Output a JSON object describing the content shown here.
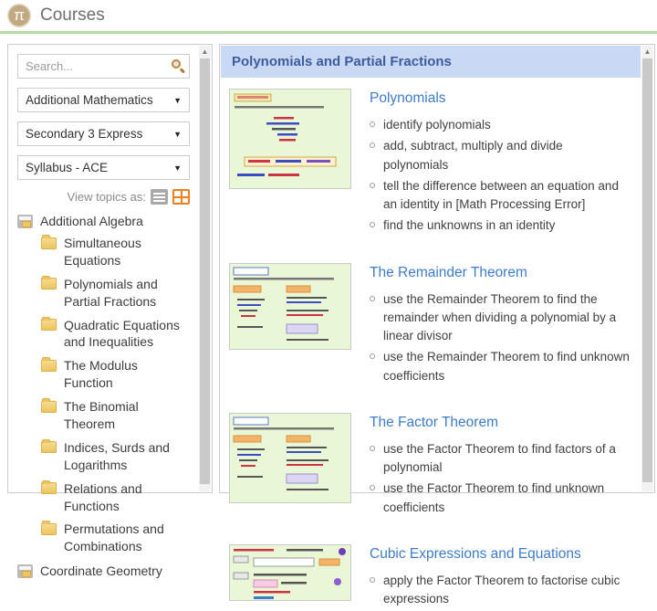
{
  "header": {
    "title": "Courses",
    "logo_glyph": "π"
  },
  "colors": {
    "accent_green": "#b4dba4",
    "logo_tan": "#c2a982",
    "header_blue": "#c9d9f3",
    "link_blue": "#3d7cc9",
    "folder_yellow": "#f0c75e",
    "orange": "#ee7f1b"
  },
  "sidebar": {
    "search_placeholder": "Search...",
    "filters": [
      {
        "name": "subject-dropdown",
        "value": "Additional Mathematics"
      },
      {
        "name": "level-dropdown",
        "value": "Secondary 3 Express"
      },
      {
        "name": "syllabus-dropdown",
        "value": "Syllabus - ACE"
      }
    ],
    "view_topics_label": "View topics as:",
    "tree": [
      {
        "label": "Additional Algebra",
        "type": "category",
        "children": [
          "Simultaneous Equations",
          "Polynomials and Partial Fractions",
          "Quadratic Equations and Inequalities",
          "The Modulus Function",
          "The Binomial Theorem",
          "Indices, Surds and Logarithms",
          "Relations and Functions",
          "Permutations and Combinations"
        ]
      },
      {
        "label": "Coordinate Geometry",
        "type": "category",
        "children": []
      }
    ]
  },
  "main": {
    "header": "Polynomials and Partial Fractions",
    "topics": [
      {
        "title": "Polynomials",
        "thumb_variant": 1,
        "thumb_height": 108,
        "objectives": [
          "identify polynomials",
          "add, subtract, multiply and divide polynomials",
          "tell the difference between an equation and an identity in [Math Processing Error]",
          "find the unknowns in an identity"
        ]
      },
      {
        "title": "The Remainder Theorem",
        "thumb_variant": 2,
        "thumb_height": 93,
        "objectives": [
          "use the Remainder Theorem to find the remainder when dividing a polynomial by a linear divisor",
          "use the Remainder Theorem to find unknown coefficients"
        ]
      },
      {
        "title": "The Factor Theorem",
        "thumb_variant": 3,
        "thumb_height": 97,
        "objectives": [
          "use the Factor Theorem to find factors of a polynomial",
          "use the Factor Theorem to find unknown coefficients"
        ]
      },
      {
        "title": "Cubic Expressions and Equations",
        "thumb_variant": 4,
        "thumb_height": 60,
        "objectives": [
          "apply the Factor Theorem to factorise cubic expressions"
        ]
      }
    ]
  }
}
